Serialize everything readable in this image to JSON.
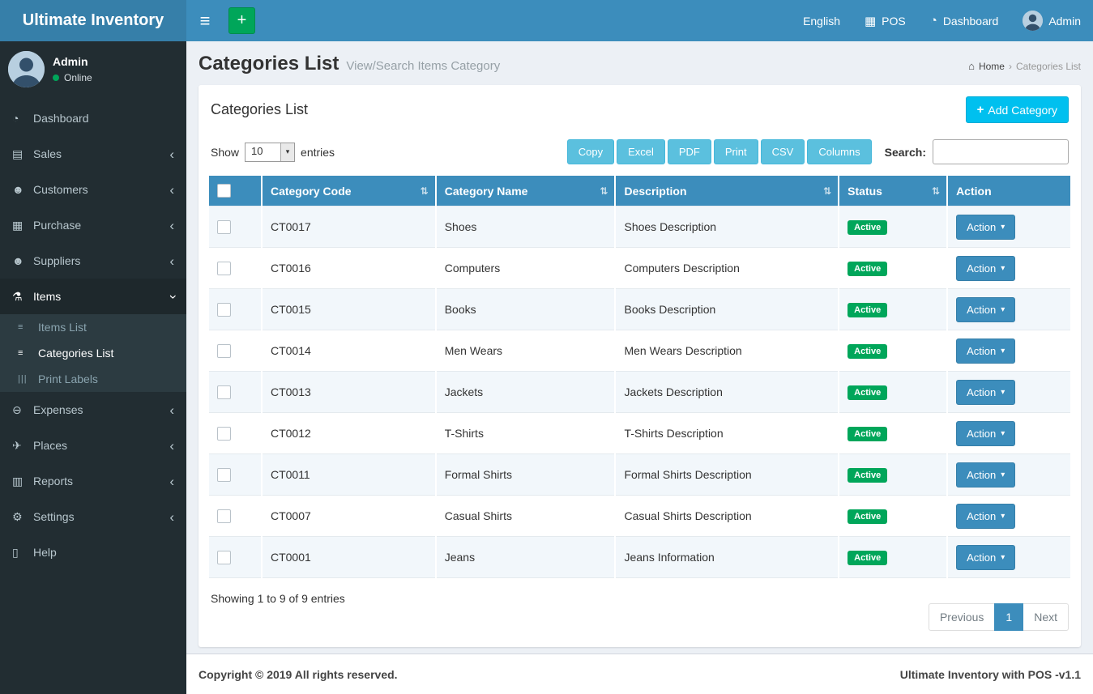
{
  "navbar": {
    "brand": "Ultimate Inventory",
    "language": "English",
    "pos": "POS",
    "dashboard": "Dashboard",
    "user": "Admin"
  },
  "icons": {
    "hamburger": "≡",
    "plus": "+",
    "pos": "▦",
    "dashboard": "◔",
    "home": "⌂",
    "sort": "⇅",
    "caret_down": "▾",
    "chevron": "‹",
    "select_arrow": "▾",
    "breadcrumb_sep": "›"
  },
  "sidebar": {
    "user_name": "Admin",
    "user_status": "Online",
    "menu": [
      {
        "label": "Dashboard",
        "glyph": "◔"
      },
      {
        "label": "Sales",
        "glyph": "▤"
      },
      {
        "label": "Customers",
        "glyph": "☻"
      },
      {
        "label": "Purchase",
        "glyph": "▦"
      },
      {
        "label": "Suppliers",
        "glyph": "☻"
      },
      {
        "label": "Items",
        "glyph": "⚗"
      },
      {
        "label": "Expenses",
        "glyph": "⊖"
      },
      {
        "label": "Places",
        "glyph": "✈"
      },
      {
        "label": "Reports",
        "glyph": "▥"
      },
      {
        "label": "Settings",
        "glyph": "⚙"
      },
      {
        "label": "Help",
        "glyph": "▯"
      }
    ],
    "items_submenu": [
      {
        "label": "Items List",
        "glyph": "≡"
      },
      {
        "label": "Categories List",
        "glyph": "≡"
      },
      {
        "label": "Print Labels",
        "glyph": "|||"
      }
    ]
  },
  "header": {
    "title": "Categories List",
    "subtitle": "View/Search Items Category",
    "breadcrumb_home": "Home",
    "breadcrumb_current": "Categories List"
  },
  "panel": {
    "title": "Categories List",
    "add_button": "Add Category",
    "show_label": "Show",
    "page_length": "10",
    "entries_label": "entries",
    "export_buttons": [
      "Copy",
      "Excel",
      "PDF",
      "Print",
      "CSV",
      "Columns"
    ],
    "search_label": "Search:",
    "table": {
      "headers": [
        "Category Code",
        "Category Name",
        "Description",
        "Status",
        "Action"
      ],
      "rows": [
        {
          "code": "CT0017",
          "name": "Shoes",
          "description": "Shoes Description",
          "status": "Active",
          "action_label": "Action"
        },
        {
          "code": "CT0016",
          "name": "Computers",
          "description": "Computers Description",
          "status": "Active",
          "action_label": "Action"
        },
        {
          "code": "CT0015",
          "name": "Books",
          "description": "Books Description",
          "status": "Active",
          "action_label": "Action"
        },
        {
          "code": "CT0014",
          "name": "Men Wears",
          "description": "Men Wears Description",
          "status": "Active",
          "action_label": "Action"
        },
        {
          "code": "CT0013",
          "name": "Jackets",
          "description": "Jackets Description",
          "status": "Active",
          "action_label": "Action"
        },
        {
          "code": "CT0012",
          "name": "T-Shirts",
          "description": "T-Shirts Description",
          "status": "Active",
          "action_label": "Action"
        },
        {
          "code": "CT0011",
          "name": "Formal Shirts",
          "description": "Formal Shirts Description",
          "status": "Active",
          "action_label": "Action"
        },
        {
          "code": "CT0007",
          "name": "Casual Shirts",
          "description": "Casual Shirts Description",
          "status": "Active",
          "action_label": "Action"
        },
        {
          "code": "CT0001",
          "name": "Jeans",
          "description": "Jeans Information",
          "status": "Active",
          "action_label": "Action"
        }
      ]
    },
    "showing_text": "Showing 1 to 9 of 9 entries",
    "pagination": {
      "previous": "Previous",
      "page": "1",
      "next": "Next"
    }
  },
  "footer": {
    "copyright": "Copyright © 2019 All rights reserved.",
    "version": "Ultimate Inventory with POS -v1.1"
  },
  "colors": {
    "navbar_blue": "#3c8dbc",
    "logo_blue": "#367fa9",
    "sidebar_dark": "#222d32",
    "success_green": "#00a65a",
    "export_cyan": "#5bc0de",
    "add_cyan": "#00c0ef",
    "stripe_blue": "#f2f7fb"
  }
}
